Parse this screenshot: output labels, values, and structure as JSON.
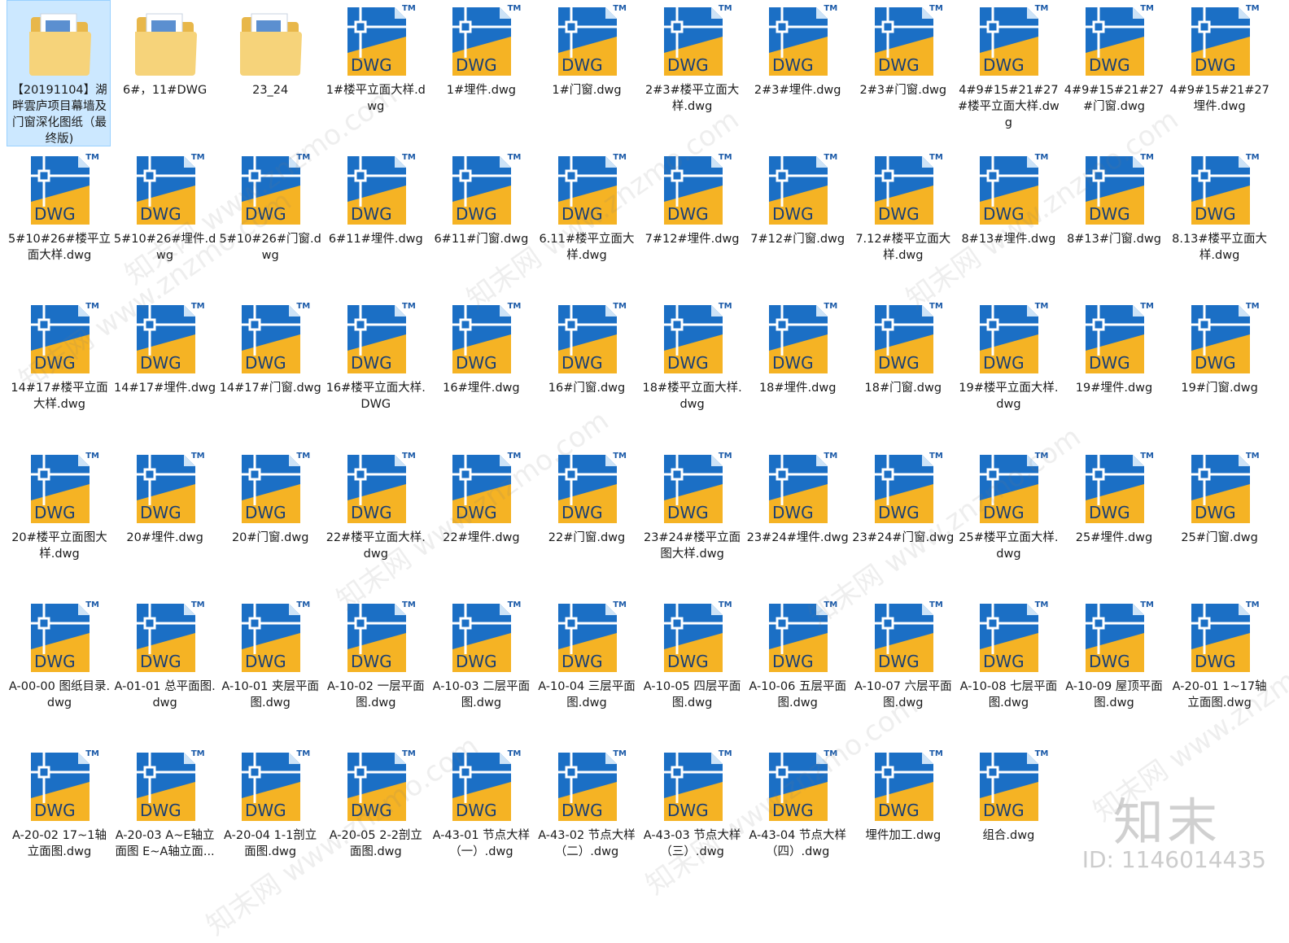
{
  "columns": 12,
  "colors": {
    "selection_bg": "#cce8ff",
    "dwg_blue": "#1b6fc5",
    "dwg_yellow": "#f5b324",
    "folder_yellow": "#f6d37a"
  },
  "icon_names": {
    "folder": "folder-icon",
    "dwg": "dwg-file-icon"
  },
  "dwg_icon": {
    "text": "DWG",
    "mark": "TM"
  },
  "items": [
    {
      "type": "folder",
      "label": "【20191104】湖畔雲庐项目幕墙及门窗深化图纸（最终版)",
      "selected": true
    },
    {
      "type": "folder",
      "label": "6#，11#DWG"
    },
    {
      "type": "folder",
      "label": "23_24"
    },
    {
      "type": "dwg",
      "label": "1#楼平立面大样.dwg"
    },
    {
      "type": "dwg",
      "label": "1#埋件.dwg"
    },
    {
      "type": "dwg",
      "label": "1#门窗.dwg"
    },
    {
      "type": "dwg",
      "label": "2#3#楼平立面大样.dwg"
    },
    {
      "type": "dwg",
      "label": "2#3#埋件.dwg"
    },
    {
      "type": "dwg",
      "label": "2#3#门窗.dwg"
    },
    {
      "type": "dwg",
      "label": "4#9#15#21#27#楼平立面大样.dwg"
    },
    {
      "type": "dwg",
      "label": "4#9#15#21#27#门窗.dwg"
    },
    {
      "type": "dwg",
      "label": "4#9#15#21#27埋件.dwg"
    },
    {
      "type": "dwg",
      "label": "5#10#26#楼平立面大样.dwg"
    },
    {
      "type": "dwg",
      "label": "5#10#26#埋件.dwg"
    },
    {
      "type": "dwg",
      "label": "5#10#26#门窗.dwg"
    },
    {
      "type": "dwg",
      "label": "6#11#埋件.dwg"
    },
    {
      "type": "dwg",
      "label": "6#11#门窗.dwg"
    },
    {
      "type": "dwg",
      "label": "6.11#楼平立面大样.dwg"
    },
    {
      "type": "dwg",
      "label": "7#12#埋件.dwg"
    },
    {
      "type": "dwg",
      "label": "7#12#门窗.dwg"
    },
    {
      "type": "dwg",
      "label": "7.12#楼平立面大样.dwg"
    },
    {
      "type": "dwg",
      "label": "8#13#埋件.dwg"
    },
    {
      "type": "dwg",
      "label": "8#13#门窗.dwg"
    },
    {
      "type": "dwg",
      "label": "8.13#楼平立面大样.dwg"
    },
    {
      "type": "dwg",
      "label": "14#17#楼平立面大样.dwg"
    },
    {
      "type": "dwg",
      "label": "14#17#埋件.dwg"
    },
    {
      "type": "dwg",
      "label": "14#17#门窗.dwg"
    },
    {
      "type": "dwg",
      "label": "16#楼平立面大样.DWG"
    },
    {
      "type": "dwg",
      "label": "16#埋件.dwg"
    },
    {
      "type": "dwg",
      "label": "16#门窗.dwg"
    },
    {
      "type": "dwg",
      "label": "18#楼平立面大样.dwg"
    },
    {
      "type": "dwg",
      "label": "18#埋件.dwg"
    },
    {
      "type": "dwg",
      "label": "18#门窗.dwg"
    },
    {
      "type": "dwg",
      "label": "19#楼平立面大样.dwg"
    },
    {
      "type": "dwg",
      "label": "19#埋件.dwg"
    },
    {
      "type": "dwg",
      "label": "19#门窗.dwg"
    },
    {
      "type": "dwg",
      "label": "20#楼平立面图大样.dwg"
    },
    {
      "type": "dwg",
      "label": "20#埋件.dwg"
    },
    {
      "type": "dwg",
      "label": "20#门窗.dwg"
    },
    {
      "type": "dwg",
      "label": "22#楼平立面大样.dwg"
    },
    {
      "type": "dwg",
      "label": "22#埋件.dwg"
    },
    {
      "type": "dwg",
      "label": "22#门窗.dwg"
    },
    {
      "type": "dwg",
      "label": "23#24#楼平立面图大样.dwg"
    },
    {
      "type": "dwg",
      "label": "23#24#埋件.dwg"
    },
    {
      "type": "dwg",
      "label": "23#24#门窗.dwg"
    },
    {
      "type": "dwg",
      "label": "25#楼平立面大样.dwg"
    },
    {
      "type": "dwg",
      "label": "25#埋件.dwg"
    },
    {
      "type": "dwg",
      "label": "25#门窗.dwg"
    },
    {
      "type": "dwg",
      "label": "A-00-00 图纸目录.dwg"
    },
    {
      "type": "dwg",
      "label": "A-01-01 总平面图.dwg"
    },
    {
      "type": "dwg",
      "label": "A-10-01 夹层平面图.dwg"
    },
    {
      "type": "dwg",
      "label": "A-10-02 一层平面图.dwg"
    },
    {
      "type": "dwg",
      "label": "A-10-03 二层平面图.dwg"
    },
    {
      "type": "dwg",
      "label": "A-10-04 三层平面图.dwg"
    },
    {
      "type": "dwg",
      "label": "A-10-05 四层平面图.dwg"
    },
    {
      "type": "dwg",
      "label": "A-10-06 五层平面图.dwg"
    },
    {
      "type": "dwg",
      "label": "A-10-07 六层平面图.dwg"
    },
    {
      "type": "dwg",
      "label": "A-10-08 七层平面图.dwg"
    },
    {
      "type": "dwg",
      "label": "A-10-09 屋顶平面图.dwg"
    },
    {
      "type": "dwg",
      "label": "A-20-01 1~17轴立面图.dwg"
    },
    {
      "type": "dwg",
      "label": "A-20-02 17~1轴立面图.dwg"
    },
    {
      "type": "dwg",
      "label": "A-20-03 A~E轴立面图 E~A轴立面..."
    },
    {
      "type": "dwg",
      "label": "A-20-04 1-1剖立面图.dwg"
    },
    {
      "type": "dwg",
      "label": "A-20-05 2-2剖立面图.dwg"
    },
    {
      "type": "dwg",
      "label": "A-43-01 节点大样（一）.dwg"
    },
    {
      "type": "dwg",
      "label": "A-43-02 节点大样（二）.dwg"
    },
    {
      "type": "dwg",
      "label": "A-43-03 节点大样（三）.dwg"
    },
    {
      "type": "dwg",
      "label": "A-43-04 节点大样（四）.dwg"
    },
    {
      "type": "dwg",
      "label": "埋件加工.dwg"
    },
    {
      "type": "dwg",
      "label": "组合.dwg"
    }
  ],
  "watermark": {
    "text": "知末网 www.znzmo.com",
    "brand": "知末",
    "id": "ID: 1146014435"
  }
}
